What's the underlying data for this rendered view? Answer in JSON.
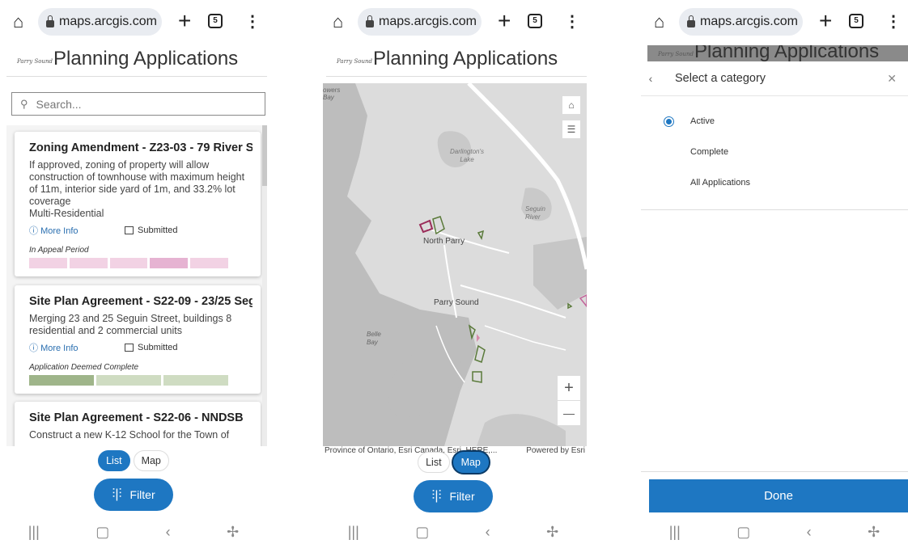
{
  "browser": {
    "url": "maps.arcgis.com",
    "tab_count": "5"
  },
  "app": {
    "title": "Planning Applications",
    "logo_text": "Parry Sound"
  },
  "list_view": {
    "search_placeholder": "Search...",
    "cards": [
      {
        "title": "Zoning Amendment - Z23-03 - 79 River S",
        "description": "If approved, zoning of property will allow construction of townhouse with maximum height of 11m, interior side yard of 1m, and 33.2% lot coverage",
        "type": "Multi-Residential",
        "more_info": "More Info",
        "status": "Submitted",
        "phase": "In Appeal Period",
        "progress_colors": [
          "#f2d2e4",
          "#f2d2e4",
          "#f2d2e4",
          "#e6b3d2",
          "#f2d2e4"
        ]
      },
      {
        "title": "Site Plan Agreement - S22-09 - 23/25 Seg",
        "description": "Merging 23 and 25 Seguin Street, buildings 8 residential and 2 commercial units",
        "more_info": "More Info",
        "status": "Submitted",
        "phase": "Application Deemed Complete",
        "progress_colors": [
          "#9fb58a",
          "#cfdcc2",
          "#cfdcc2"
        ]
      },
      {
        "title": "Site Plan Agreement - S22-06 - NNDSB",
        "description": "Construct a new K-12 School for the Town of"
      }
    ]
  },
  "toggle": {
    "list_label": "List",
    "map_label": "Map"
  },
  "filter_label": "Filter",
  "map_view": {
    "labels": {
      "powers_bay": "owers Bay",
      "darlingtons_lake": "Darlington's Lake",
      "seguin_river": "Seguin River",
      "north_parry": "North Parry",
      "parry_sound": "Parry Sound",
      "belle_bay": "Belle Bay"
    },
    "zoom_in": "+",
    "zoom_out": "—",
    "attribution": "Province of Ontario, Esri Canada, Esri, HERE,...",
    "powered_by": "Powered by Esri"
  },
  "category_panel": {
    "title": "Select a category",
    "options": [
      {
        "label": "Active",
        "selected": true
      },
      {
        "label": "Complete",
        "selected": false
      },
      {
        "label": "All Applications",
        "selected": false
      }
    ],
    "done_label": "Done"
  },
  "colors": {
    "accent": "#1e77c2",
    "map_land": "#dcdcdc",
    "map_water": "#b9b9b9",
    "map_road": "#ffffff"
  }
}
